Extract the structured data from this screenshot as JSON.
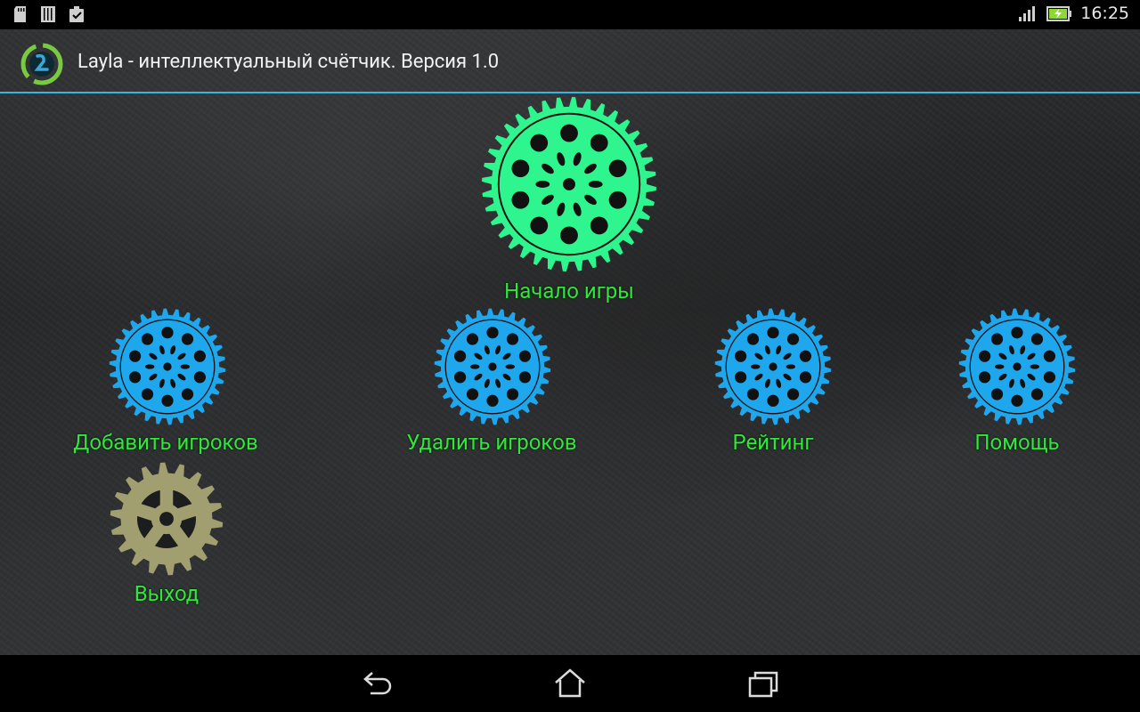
{
  "status_bar": {
    "time": "16:25",
    "icons_left": [
      "sd-card-icon",
      "barcode-icon",
      "clipboard-check-icon"
    ],
    "icons_right": [
      "signal-icon",
      "battery-charging-icon"
    ]
  },
  "action_bar": {
    "title": "Layla - интеллектуальный счётчик. Версия 1.0",
    "accent_color": "#33b5e5"
  },
  "menu": {
    "start": {
      "label": "Начало игры",
      "color": "#2ef58e"
    },
    "add_players": {
      "label": "Добавить игроков",
      "color": "#1fa7ee"
    },
    "remove_players": {
      "label": "Удалить игроков",
      "color": "#1fa7ee"
    },
    "rating": {
      "label": "Рейтинг",
      "color": "#1fa7ee"
    },
    "help": {
      "label": "Помощь",
      "color": "#1fa7ee"
    },
    "exit": {
      "label": "Выход",
      "color": "#a19f70"
    },
    "label_color": "#2ee83a"
  },
  "nav_bar": {
    "buttons": [
      "back-icon",
      "home-icon",
      "recent-apps-icon"
    ]
  }
}
